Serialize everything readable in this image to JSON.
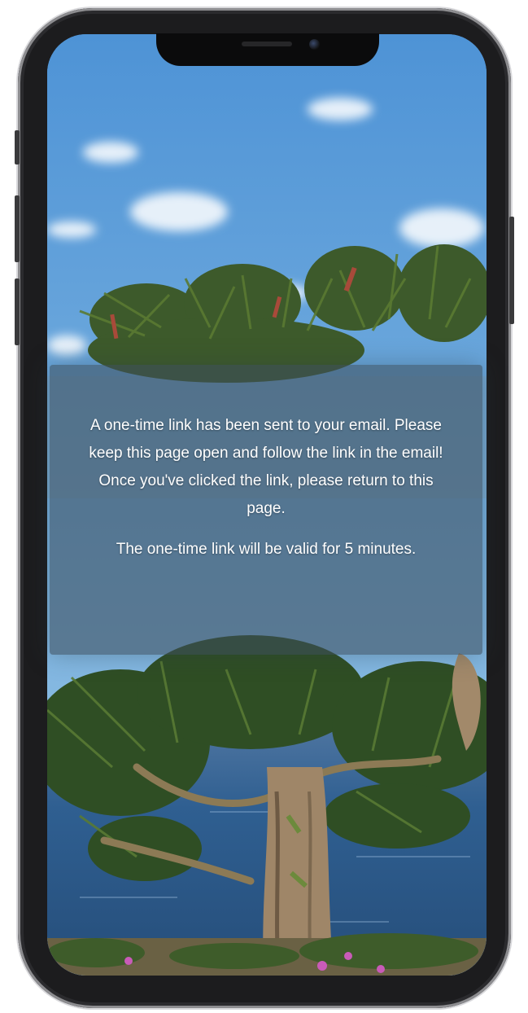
{
  "message": {
    "line1": "A one-time link has been sent to your email. Please keep this page open and follow the link in the email! Once you've clicked the link, please return to this page.",
    "line2": "The one-time link will be valid for 5 minutes."
  },
  "colors": {
    "sky": "#5d9ed9",
    "water": "#2f5f91",
    "panel": "#3c4e5c",
    "text": "#ffffff"
  },
  "icons": [
    "camera-icon",
    "speaker-grille-icon"
  ]
}
